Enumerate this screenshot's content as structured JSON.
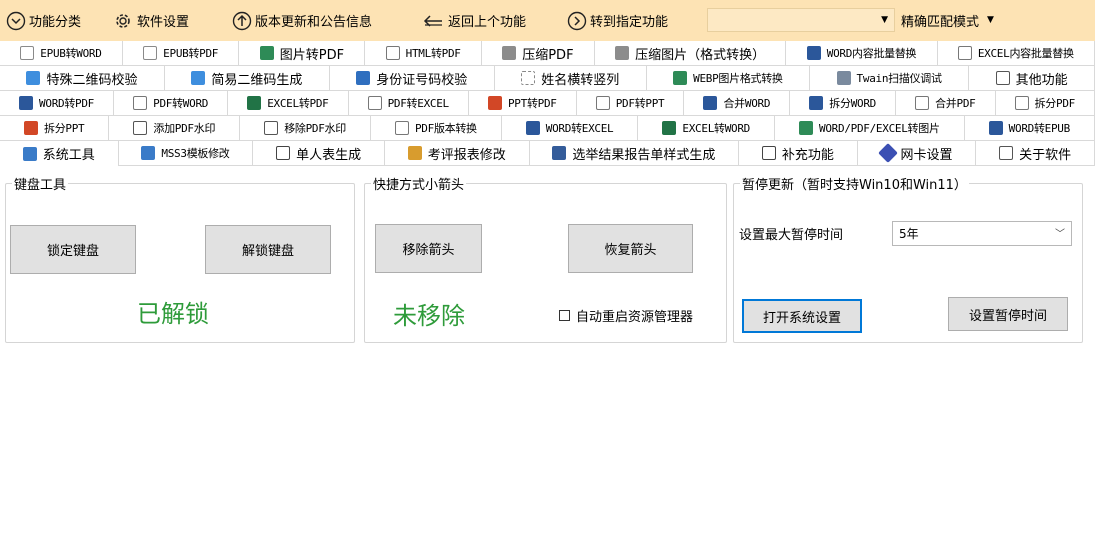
{
  "toolbar": {
    "categories": "功能分类",
    "settings": "软件设置",
    "updates": "版本更新和公告信息",
    "back": "返回上个功能",
    "goto": "转到指定功能",
    "search_value": "",
    "match_mode": "精确匹配模式"
  },
  "tab_rows": [
    [
      {
        "label": "EPUB转WORD",
        "icon": "doc-icon",
        "font": "mono"
      },
      {
        "label": "EPUB转PDF",
        "icon": "doc-icon",
        "font": "mono"
      },
      {
        "label": "图片转PDF",
        "icon": "image-icon",
        "font": "sans"
      },
      {
        "label": "HTML转PDF",
        "icon": "html-icon",
        "font": "mono"
      },
      {
        "label": "压缩PDF",
        "icon": "compress-icon",
        "font": "sans"
      },
      {
        "label": "压缩图片（格式转换）",
        "icon": "compress-icon",
        "font": "sans"
      },
      {
        "label": "WORD内容批量替换",
        "icon": "word-icon",
        "font": "mono"
      },
      {
        "label": "EXCEL内容批量替换",
        "icon": "html-icon",
        "font": "mono"
      }
    ],
    [
      {
        "label": "特殊二维码校验",
        "icon": "qr-icon",
        "font": "sans"
      },
      {
        "label": "简易二维码生成",
        "icon": "qr-icon",
        "font": "sans"
      },
      {
        "label": "身份证号码校验",
        "icon": "id-card-icon",
        "font": "sans"
      },
      {
        "label": "姓名横转竖列",
        "icon": "name-icon",
        "font": "sans"
      },
      {
        "label": "WEBP图片格式转换",
        "icon": "image-icon",
        "font": "mono"
      },
      {
        "label": "Twain扫描仪调试",
        "icon": "scanner-icon",
        "font": "mono"
      },
      {
        "label": "其他功能",
        "icon": "more-icon",
        "font": "sans"
      }
    ],
    [
      {
        "label": "WORD转PDF",
        "icon": "word-icon",
        "font": "mono"
      },
      {
        "label": "PDF转WORD",
        "icon": "html-icon",
        "font": "mono"
      },
      {
        "label": "EXCEL转PDF",
        "icon": "excel-icon",
        "font": "mono"
      },
      {
        "label": "PDF转EXCEL",
        "icon": "html-icon",
        "font": "mono"
      },
      {
        "label": "PPT转PDF",
        "icon": "ppt-icon",
        "font": "mono"
      },
      {
        "label": "PDF转PPT",
        "icon": "html-icon",
        "font": "mono"
      },
      {
        "label": "合并WORD",
        "icon": "word-icon",
        "font": "mono"
      },
      {
        "label": "拆分WORD",
        "icon": "word-icon",
        "font": "mono"
      },
      {
        "label": "合并PDF",
        "icon": "html-icon",
        "font": "mono"
      },
      {
        "label": "拆分PDF",
        "icon": "html-icon",
        "font": "mono"
      }
    ],
    [
      {
        "label": "拆分PPT",
        "icon": "ppt-icon",
        "font": "mono"
      },
      {
        "label": "添加PDF水印",
        "icon": "watermark-icon",
        "font": "mono"
      },
      {
        "label": "移除PDF水印",
        "icon": "watermark-icon",
        "font": "mono"
      },
      {
        "label": "PDF版本转换",
        "icon": "html-icon",
        "font": "mono"
      },
      {
        "label": "WORD转EXCEL",
        "icon": "word-icon",
        "font": "mono"
      },
      {
        "label": "EXCEL转WORD",
        "icon": "excel-icon",
        "font": "mono"
      },
      {
        "label": "WORD/PDF/EXCEL转图片",
        "icon": "image-icon",
        "font": "mono"
      },
      {
        "label": "WORD转EPUB",
        "icon": "word-icon",
        "font": "mono"
      }
    ],
    [
      {
        "label": "系统工具",
        "icon": "gear-icon",
        "font": "sans",
        "selected": true
      },
      {
        "label": "MSS3模板修改",
        "icon": "gear-icon",
        "font": "mono"
      },
      {
        "label": "单人表生成",
        "icon": "table-icon",
        "font": "sans"
      },
      {
        "label": "考评报表修改",
        "icon": "score-icon",
        "font": "sans"
      },
      {
        "label": "选举结果报告单样式生成",
        "icon": "list-icon",
        "font": "sans"
      },
      {
        "label": "补充功能",
        "icon": "file-icon",
        "font": "sans"
      },
      {
        "label": "网卡设置",
        "icon": "network-icon",
        "font": "sans"
      },
      {
        "label": "关于软件",
        "icon": "info-icon",
        "font": "sans"
      }
    ]
  ],
  "keyboard": {
    "title": "键盘工具",
    "lock_label": "锁定键盘",
    "unlock_label": "解锁键盘",
    "status": "已解锁"
  },
  "shortcut": {
    "title": "快捷方式小箭头",
    "remove_label": "移除箭头",
    "restore_label": "恢复箭头",
    "status": "未移除",
    "auto_restart_label": "自动重启资源管理器",
    "auto_restart_checked": false
  },
  "update": {
    "title": "暂停更新（暂时支持Win10和Win11）",
    "max_time_label": "设置最大暂停时间",
    "max_time_value": "5年",
    "open_settings_label": "打开系统设置",
    "set_time_label": "设置暂停时间"
  },
  "colors": {
    "toolbar_bg": "#fde3b4",
    "status_green": "#2e9b3a",
    "focus_blue": "#0078d7"
  }
}
